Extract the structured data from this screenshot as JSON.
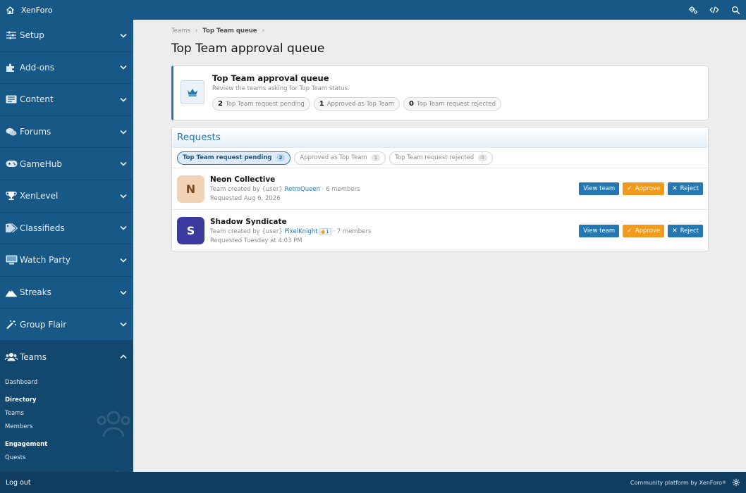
{
  "topbar": {
    "brand": "XenForo",
    "icons": [
      "home-icon",
      "cogs-icon",
      "code-icon",
      "search-icon"
    ]
  },
  "sidebar": {
    "items": [
      {
        "label": "Setup",
        "icon": "sliders-icon"
      },
      {
        "label": "Add-ons",
        "icon": "puzzle-icon"
      },
      {
        "label": "Content",
        "icon": "content-icon"
      },
      {
        "label": "Forums",
        "icon": "comments-icon"
      },
      {
        "label": "GameHub",
        "icon": "gamepad-icon"
      },
      {
        "label": "XenLevel",
        "icon": "trophy-icon"
      },
      {
        "label": "Classifieds",
        "icon": "tags-icon"
      },
      {
        "label": "Watch Party",
        "icon": "monitor-icon"
      },
      {
        "label": "Streaks",
        "icon": "mountain-icon"
      },
      {
        "label": "Group Flair",
        "icon": "magic-wand-icon"
      }
    ],
    "active": {
      "label": "Teams",
      "icon": "users-icon",
      "links": {
        "dashboard": "Dashboard",
        "directory_head": "Directory",
        "teams": "Teams",
        "members": "Members",
        "engagement_head": "Engagement",
        "quests": "Quests"
      }
    }
  },
  "breadcrumb": {
    "root": "Teams",
    "current": "Top Team queue"
  },
  "page_title": "Top Team approval queue",
  "info": {
    "title": "Top Team approval queue",
    "description": "Review the teams asking for Top Team status.",
    "stats": [
      {
        "count": "2",
        "label": "Top Team request pending"
      },
      {
        "count": "1",
        "label": "Approved as Top Team"
      },
      {
        "count": "0",
        "label": "Top Team request rejected"
      }
    ]
  },
  "requests": {
    "heading": "Requests",
    "filters": [
      {
        "label": "Top Team request pending",
        "count": "2"
      },
      {
        "label": "Approved as Top Team",
        "count": "1"
      },
      {
        "label": "Top Team request rejected",
        "count": "0"
      }
    ],
    "rows": [
      {
        "initial": "N",
        "name": "Neon Collective",
        "created_prefix": "Team created by {user}",
        "user": "RetroQueen",
        "badge": "",
        "members": "· 6 members",
        "requested": "Requested Aug 6, 2026",
        "avatar_bg": "#f1d2b4",
        "avatar_fg": "#7a4a1e"
      },
      {
        "initial": "S",
        "name": "Shadow Syndicate",
        "created_prefix": "Team created by {user}",
        "user": "PixelKnight",
        "badge": "1",
        "members": "· 7 members",
        "requested": "Requested Tuesday at 4:03 PM",
        "avatar_bg": "#3b3a9e",
        "avatar_fg": "#ffffff"
      }
    ],
    "buttons": {
      "view": "View team",
      "approve": "Approve",
      "reject": "Reject"
    }
  },
  "footer": {
    "logout": "Log out",
    "powered": "Community platform by XenForo",
    "trademark": "®"
  },
  "colors": {
    "brand": "#185886",
    "accent": "#2577b1",
    "approve": "#f29a1d"
  }
}
